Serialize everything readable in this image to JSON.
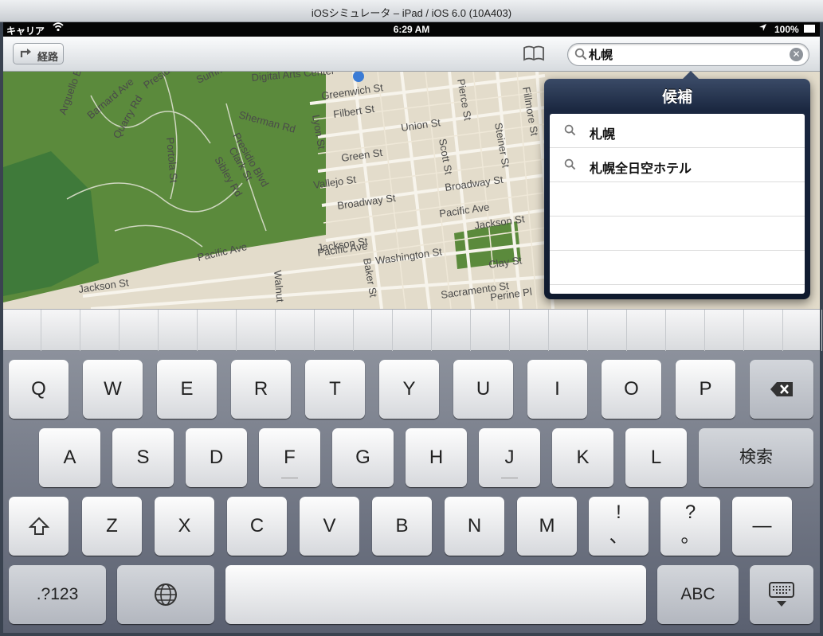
{
  "window": {
    "title": "iOSシミュレータ – iPad / iOS 6.0 (10A403)"
  },
  "status": {
    "carrier": "キャリア",
    "time": "6:29 AM",
    "battery": "100%"
  },
  "nav": {
    "route_label": "経路",
    "search_value": "札幌"
  },
  "popover": {
    "title": "候補",
    "suggestions": [
      "札幌",
      "札幌全日空ホテル"
    ]
  },
  "map": {
    "streets": [
      "Greenwich St",
      "Filbert St",
      "Union St",
      "Green St",
      "Vallejo St",
      "Broadway St",
      "Broadway St",
      "Pacific Ave",
      "Pacific Ave",
      "Pacific Ave",
      "Jackson St",
      "Jackson St",
      "Jackson St",
      "Washington St",
      "Clay St",
      "Sacramento St",
      "Perine Pl",
      "Sherman Rd",
      "Lyon St",
      "Presidio Blvd",
      "Presidio Blvd",
      "Clark St",
      "Sibley Rd",
      "Portola St",
      "Quarry Rd",
      "Barnard Ave",
      "Arguello Blvd",
      "Summer Ave",
      "Baker St",
      "Scott St",
      "Steiner St",
      "Fillmore St",
      "Pierce St",
      "Walnut",
      "Digital Arts Center"
    ],
    "colors": {
      "park": "#5b8a3c",
      "land": "#e3dccb",
      "street": "#f7f4ec"
    }
  },
  "keyboard": {
    "row1": [
      "Q",
      "W",
      "E",
      "R",
      "T",
      "Y",
      "U",
      "I",
      "O",
      "P"
    ],
    "row2": [
      "A",
      "S",
      "D",
      "F",
      "G",
      "H",
      "J",
      "K",
      "L"
    ],
    "row3": [
      "Z",
      "X",
      "C",
      "V",
      "B",
      "N",
      "M"
    ],
    "search_key": "検索",
    "punct1": [
      "!",
      "、"
    ],
    "punct2": [
      "?",
      "。"
    ],
    "dash": "—",
    "numbers_key": ".?123",
    "abc_key": "ABC"
  }
}
